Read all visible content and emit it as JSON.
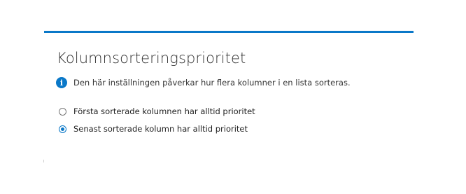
{
  "section": {
    "title": "Kolumnsorteringsprioritet",
    "info_icon": "info-icon",
    "info_text": "Den här inställningen påverkar hur flera kolumner i en lista sorteras.",
    "accent_color": "#0a78c8"
  },
  "options": [
    {
      "label": "Första sorterade kolumnen har alltid prioritet",
      "selected": false
    },
    {
      "label": "Senast sorterade kolumn har alltid prioritet",
      "selected": true
    }
  ]
}
